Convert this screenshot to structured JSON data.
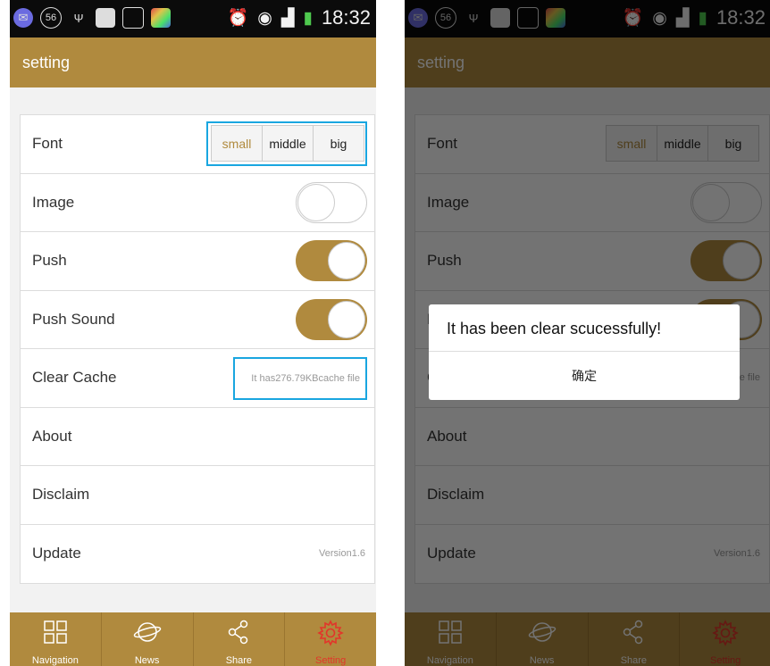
{
  "status": {
    "time": "18:32",
    "notification_icons": [
      "alert-icon",
      "badge-56-icon",
      "usb-icon",
      "storage-icon",
      "gallery-icon",
      "app-icon"
    ],
    "badge": "56"
  },
  "app": {
    "title": "setting"
  },
  "settings": {
    "font_label": "Font",
    "font_options": [
      "small",
      "middle",
      "big"
    ],
    "font_selected": "small",
    "image_label": "Image",
    "image_enabled": false,
    "push_label": "Push",
    "push_enabled": true,
    "push_sound_label": "Push Sound",
    "push_sound_enabled": true,
    "clear_cache_label": "Clear Cache",
    "cache_info": "It has276.79KBcache file",
    "about_label": "About",
    "disclaim_label": "Disclaim",
    "update_label": "Update",
    "version": "Version1.6"
  },
  "tabs": [
    {
      "label": "Navigation",
      "icon": "grid-icon"
    },
    {
      "label": "News",
      "icon": "planet-icon"
    },
    {
      "label": "Share",
      "icon": "share-icon"
    },
    {
      "label": "Setting",
      "icon": "gear-icon",
      "active": true
    }
  ],
  "dialog": {
    "message": "It has been clear scucessfully!",
    "confirm_label": "确定"
  },
  "colors": {
    "accent": "#b08a3e",
    "highlight_box": "#19a6e0",
    "active_tab": "#e2352a"
  }
}
